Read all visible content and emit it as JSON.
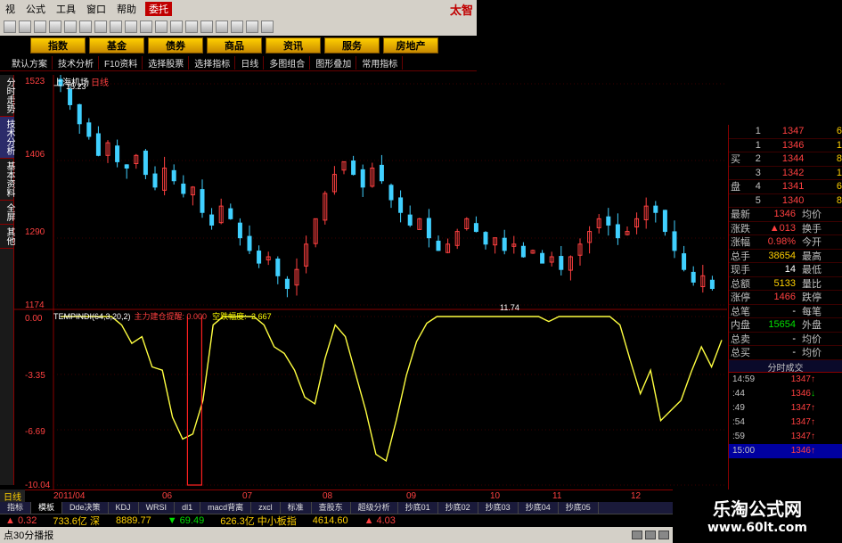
{
  "menubar": {
    "items": [
      "视",
      "公式",
      "工具",
      "窗口",
      "帮助"
    ],
    "highlight": "委托",
    "logo": "太智"
  },
  "categories": [
    "指数",
    "基金",
    "债券",
    "商品",
    "资讯",
    "服务",
    "房地产"
  ],
  "funcbar": [
    "默认方案",
    "技术分析",
    "F10资料",
    "选择股票",
    "选择指标",
    "日线",
    "多图组合",
    "图形叠加",
    "常用指标"
  ],
  "lefttabs": [
    "分时走势",
    "技术分析",
    "基本资料",
    "全屏",
    "其他"
  ],
  "chart": {
    "symbol": "上海机场",
    "period": "日线",
    "price_labels": [
      "1523",
      "1406",
      "1290",
      "1174"
    ],
    "ind_labels": [
      "0.00",
      "-3.35",
      "-6.69",
      "-10.04"
    ],
    "high_note": "15.23",
    "low_note": "11.74",
    "ind_name": "TEMPINDI(64,3,20,2)",
    "ind_line1_label": "主力建仓提醒: 0.000",
    "ind_line2_label": "空跌幅度: -2.667"
  },
  "chart_data": {
    "type": "candlestick",
    "price_ylim": [
      11.74,
      15.23
    ],
    "indicator_ylim": [
      -10.04,
      0.0
    ],
    "price_close": [
      15.2,
      14.9,
      14.6,
      14.4,
      14.1,
      14.3,
      14.0,
      13.9,
      14.1,
      13.8,
      13.6,
      13.9,
      13.7,
      13.5,
      13.6,
      13.2,
      13.0,
      13.3,
      13.1,
      12.8,
      12.6,
      12.4,
      12.5,
      12.2,
      12.0,
      12.3,
      12.7,
      13.1,
      13.5,
      13.8,
      14.0,
      13.8,
      13.6,
      13.9,
      13.7,
      13.4,
      13.2,
      13.0,
      13.1,
      12.8,
      12.6,
      12.7,
      12.9,
      13.1,
      12.9,
      12.7,
      12.8,
      12.6,
      12.7,
      12.5,
      12.6,
      12.4,
      12.5,
      12.3,
      12.5,
      12.7,
      12.9,
      13.1,
      13.0,
      12.8,
      12.9,
      13.1,
      13.3,
      13.2,
      12.9,
      12.6,
      12.3,
      12.1,
      12.2,
      12.0
    ],
    "indicator": [
      0,
      0,
      0,
      0,
      0,
      0,
      -0.5,
      -1.6,
      -1.2,
      -3.0,
      -3.2,
      -6.0,
      -7.3,
      -7.0,
      -5.0,
      -0.5,
      0,
      0,
      0,
      0,
      -0.5,
      -1.8,
      -2.2,
      -3.2,
      -4.8,
      -5.2,
      -2.5,
      -0.5,
      -1.2,
      -3.4,
      -5.6,
      -8.2,
      -8.6,
      -6.2,
      -3.5,
      -1.5,
      -0.4,
      0,
      0,
      0,
      0,
      0,
      0,
      0,
      0,
      0,
      0,
      0,
      -0.3,
      0,
      0,
      0,
      0,
      0,
      0,
      -0.5,
      -2.6,
      -4.6,
      -3.2,
      -6.2,
      -5.6,
      -5.0,
      -3.3,
      -1.8,
      -3.0,
      -1.4
    ]
  },
  "quote": {
    "book": [
      {
        "side": "",
        "lvl": "1",
        "price": "1347",
        "vol": "6"
      },
      {
        "side": "",
        "lvl": "1",
        "price": "1346",
        "vol": "1"
      },
      {
        "side": "买",
        "lvl": "2",
        "price": "1344",
        "vol": "8"
      },
      {
        "side": "",
        "lvl": "3",
        "price": "1342",
        "vol": "1"
      },
      {
        "side": "盘",
        "lvl": "4",
        "price": "1341",
        "vol": "6"
      },
      {
        "side": "",
        "lvl": "5",
        "price": "1340",
        "vol": "8"
      }
    ],
    "stats": [
      {
        "l1": "最新",
        "v1": "1346",
        "l2": "均价"
      },
      {
        "l1": "涨跌",
        "v1": "▲013",
        "l2": "换手"
      },
      {
        "l1": "涨幅",
        "v1": "0.98%",
        "l2": "今开"
      },
      {
        "l1": "总手",
        "v1": "38654",
        "l2": "最高"
      },
      {
        "l1": "现手",
        "v1": "14",
        "l2": "最低"
      },
      {
        "l1": "总额",
        "v1": "5133",
        "l2": "量比"
      },
      {
        "l1": "涨停",
        "v1": "1466",
        "l2": "跌停"
      },
      {
        "l1": "总笔",
        "v1": "-",
        "l2": "每笔"
      },
      {
        "l1": "内盘",
        "v1": "15654",
        "l2": "外盘"
      },
      {
        "l1": "总卖",
        "v1": "-",
        "l2": "均价"
      },
      {
        "l1": "总买",
        "v1": "-",
        "l2": "均价"
      }
    ],
    "trades_title": "分时成交",
    "trades": [
      {
        "t": "14:59",
        "p": "1347",
        "d": "up"
      },
      {
        "t": ":44",
        "p": "1346",
        "d": "down"
      },
      {
        "t": ":49",
        "p": "1347",
        "d": "up"
      },
      {
        "t": ":54",
        "p": "1347",
        "d": "up"
      },
      {
        "t": ":59",
        "p": "1347",
        "d": "up"
      },
      {
        "t": "15:00",
        "p": "1346",
        "d": "up"
      }
    ]
  },
  "datebar": {
    "period": "日线",
    "dates": [
      "2011/04",
      "06",
      "07",
      "08",
      "09",
      "10",
      "11",
      "12"
    ]
  },
  "indtabs": [
    "指标",
    "模板",
    "Dde决策",
    "KDJ",
    "WRSI",
    "dl1",
    "macd背离",
    "zxcl",
    "标准",
    "查股东",
    "超级分析",
    "抄底01",
    "抄底02",
    "抄底03",
    "抄底04",
    "抄底05"
  ],
  "ticker": [
    {
      "a": "▲ 0.32",
      "b": "733.6亿 深"
    },
    {
      "a": "8889.77",
      "b": "▼ 69.49"
    },
    {
      "a": "626.3亿 中小板指",
      "b": "4614.60"
    },
    {
      "a": "▲ 4.03",
      "b": ""
    }
  ],
  "status": {
    "text": "点30分播报"
  },
  "watermark": {
    "line1": "乐淘公式网",
    "line2": "www.60lt.com"
  }
}
